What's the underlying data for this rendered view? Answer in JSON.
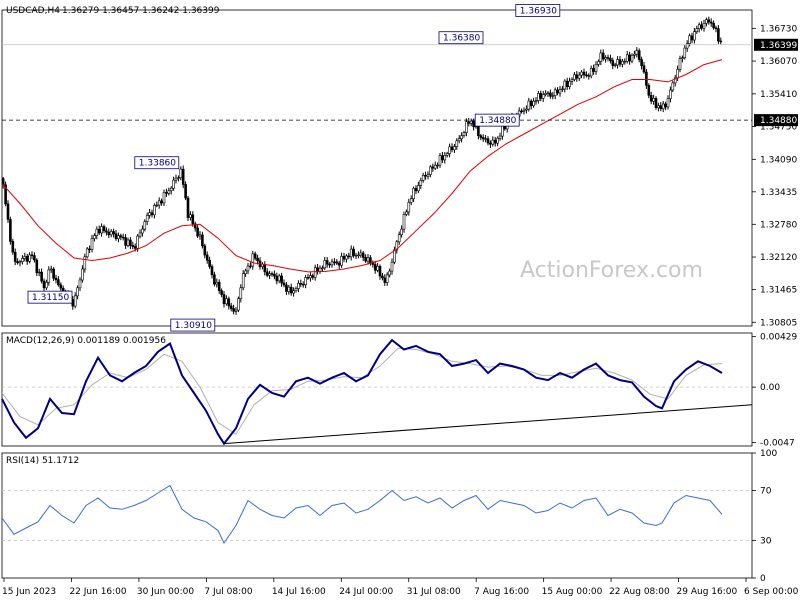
{
  "header": {
    "symbol": "USDCAD,H4",
    "ohlc": "1.36279 1.36457 1.36242 1.36399"
  },
  "watermark": "ActionForex.com",
  "colors": {
    "background": "#ffffff",
    "candle": "#000000",
    "ma": "#dd0000",
    "macd": "#000080",
    "signal": "#b0b0b0",
    "level_box_border": "#000080",
    "price_tag_bg": "#000000",
    "price_tag_text": "#ffffff",
    "grid": "#c0c0c0",
    "axis_text": "#000000",
    "watermark": "#c8c8c8"
  },
  "chart_data": [
    {
      "type": "candlestick",
      "pane": "price",
      "title": "USDCAD,H4",
      "ylim": [
        1.3073,
        1.371
      ],
      "y_ticks": [
        "1.36730",
        "1.36070",
        "1.35410",
        "1.34750",
        "1.34090",
        "1.33435",
        "1.32780",
        "1.32120",
        "1.31465",
        "1.30805"
      ],
      "x_ticks": [
        "15 Jun 2023",
        "22 Jun 16:00",
        "30 Jun 00:00",
        "7 Jul 08:00",
        "14 Jul 16:00",
        "24 Jul 00:00",
        "31 Jul 08:00",
        "7 Aug 16:00",
        "15 Aug 00:00",
        "22 Aug 08:00",
        "29 Aug 16:00",
        "6 Sep 00:00"
      ],
      "current_price": "1.36399",
      "horizontal_level": "1.34880",
      "annotations": [
        {
          "label": "1.33860",
          "value": 1.3386,
          "pos": 0.298
        },
        {
          "label": "1.31150",
          "value": 1.3115,
          "pos": 0.12
        },
        {
          "label": "1.30910",
          "value": 1.3091,
          "pos": 0.318
        },
        {
          "label": "1.36380",
          "value": 1.3638,
          "pos": 0.805
        },
        {
          "label": "1.36930",
          "value": 1.3693,
          "pos": 0.933
        },
        {
          "label": "1.34880",
          "value": 1.3488,
          "pos": 0.872
        }
      ],
      "price_path": [
        [
          0.0,
          1.337
        ],
        [
          0.02,
          1.32
        ],
        [
          0.05,
          1.3215
        ],
        [
          0.07,
          1.315
        ],
        [
          0.08,
          1.319
        ],
        [
          0.1,
          1.314
        ],
        [
          0.12,
          1.3118
        ],
        [
          0.14,
          1.322
        ],
        [
          0.16,
          1.327
        ],
        [
          0.18,
          1.326
        ],
        [
          0.2,
          1.325
        ],
        [
          0.22,
          1.323
        ],
        [
          0.24,
          1.329
        ],
        [
          0.26,
          1.332
        ],
        [
          0.28,
          1.335
        ],
        [
          0.298,
          1.3386
        ],
        [
          0.31,
          1.33
        ],
        [
          0.33,
          1.325
        ],
        [
          0.35,
          1.3175
        ],
        [
          0.37,
          1.3125
        ],
        [
          0.39,
          1.31
        ],
        [
          0.4,
          1.317
        ],
        [
          0.42,
          1.3215
        ],
        [
          0.44,
          1.318
        ],
        [
          0.46,
          1.317
        ],
        [
          0.48,
          1.314
        ],
        [
          0.5,
          1.316
        ],
        [
          0.52,
          1.318
        ],
        [
          0.54,
          1.32
        ],
        [
          0.56,
          1.32
        ],
        [
          0.58,
          1.322
        ],
        [
          0.6,
          1.3215
        ],
        [
          0.62,
          1.3195
        ],
        [
          0.64,
          1.316
        ],
        [
          0.66,
          1.325
        ],
        [
          0.68,
          1.333
        ],
        [
          0.7,
          1.337
        ],
        [
          0.72,
          1.3395
        ],
        [
          0.74,
          1.342
        ],
        [
          0.76,
          1.3445
        ],
        [
          0.78,
          1.349
        ],
        [
          0.8,
          1.345
        ],
        [
          0.82,
          1.344
        ],
        [
          0.84,
          1.348
        ],
        [
          0.86,
          1.35
        ],
        [
          0.88,
          1.352
        ],
        [
          0.9,
          1.354
        ],
        [
          0.92,
          1.354
        ],
        [
          0.94,
          1.356
        ],
        [
          0.96,
          1.358
        ],
        [
          0.98,
          1.358
        ],
        [
          1.0,
          1.362
        ],
        [
          1.02,
          1.36
        ],
        [
          1.04,
          1.361
        ],
        [
          1.06,
          1.3625
        ],
        [
          1.07,
          1.358
        ],
        [
          1.08,
          1.353
        ],
        [
          1.1,
          1.351
        ],
        [
          1.11,
          1.353
        ],
        [
          1.12,
          1.357
        ],
        [
          1.14,
          1.364
        ],
        [
          1.16,
          1.3675
        ],
        [
          1.18,
          1.369
        ],
        [
          1.2,
          1.364
        ]
      ],
      "ma_path": [
        [
          0.0,
          1.336
        ],
        [
          0.03,
          1.332
        ],
        [
          0.06,
          1.3275
        ],
        [
          0.09,
          1.324
        ],
        [
          0.12,
          1.321
        ],
        [
          0.15,
          1.3205
        ],
        [
          0.18,
          1.321
        ],
        [
          0.21,
          1.322
        ],
        [
          0.24,
          1.3235
        ],
        [
          0.27,
          1.326
        ],
        [
          0.3,
          1.3275
        ],
        [
          0.33,
          1.3278
        ],
        [
          0.36,
          1.325
        ],
        [
          0.39,
          1.3215
        ],
        [
          0.42,
          1.32
        ],
        [
          0.45,
          1.3195
        ],
        [
          0.48,
          1.3188
        ],
        [
          0.51,
          1.3182
        ],
        [
          0.54,
          1.3183
        ],
        [
          0.57,
          1.3188
        ],
        [
          0.6,
          1.3195
        ],
        [
          0.63,
          1.3205
        ],
        [
          0.66,
          1.323
        ],
        [
          0.69,
          1.3265
        ],
        [
          0.72,
          1.33
        ],
        [
          0.75,
          1.334
        ],
        [
          0.78,
          1.3385
        ],
        [
          0.81,
          1.3415
        ],
        [
          0.84,
          1.344
        ],
        [
          0.87,
          1.346
        ],
        [
          0.9,
          1.348
        ],
        [
          0.93,
          1.35
        ],
        [
          0.96,
          1.352
        ],
        [
          0.99,
          1.3535
        ],
        [
          1.02,
          1.3555
        ],
        [
          1.05,
          1.357
        ],
        [
          1.08,
          1.357
        ],
        [
          1.11,
          1.3565
        ],
        [
          1.14,
          1.358
        ],
        [
          1.17,
          1.36
        ],
        [
          1.2,
          1.361
        ]
      ]
    },
    {
      "type": "line",
      "pane": "macd",
      "title": "MACD(12,26,9) 0.001189 0.001956",
      "ylim": [
        -0.005,
        0.0046
      ],
      "y_ticks": [
        "0.00429",
        "0.00",
        "-0.0047"
      ],
      "series": [
        {
          "name": "MACD",
          "values": [
            [
              0.0,
              -0.001
            ],
            [
              0.02,
              -0.003
            ],
            [
              0.04,
              -0.0043
            ],
            [
              0.06,
              -0.0035
            ],
            [
              0.08,
              -0.001
            ],
            [
              0.1,
              -0.0022
            ],
            [
              0.12,
              -0.0023
            ],
            [
              0.14,
              0.0005
            ],
            [
              0.16,
              0.0025
            ],
            [
              0.18,
              0.001
            ],
            [
              0.2,
              0.0005
            ],
            [
              0.22,
              0.0012
            ],
            [
              0.24,
              0.0018
            ],
            [
              0.26,
              0.003
            ],
            [
              0.28,
              0.0037
            ],
            [
              0.3,
              0.001
            ],
            [
              0.32,
              -0.0005
            ],
            [
              0.34,
              -0.002
            ],
            [
              0.36,
              -0.004
            ],
            [
              0.37,
              -0.0048
            ],
            [
              0.39,
              -0.0035
            ],
            [
              0.41,
              -0.001
            ],
            [
              0.43,
              0.0002
            ],
            [
              0.45,
              -0.0005
            ],
            [
              0.47,
              -0.0008
            ],
            [
              0.49,
              0.0005
            ],
            [
              0.51,
              0.0008
            ],
            [
              0.53,
              0.0003
            ],
            [
              0.55,
              0.0008
            ],
            [
              0.57,
              0.0012
            ],
            [
              0.59,
              0.0005
            ],
            [
              0.61,
              0.001
            ],
            [
              0.63,
              0.0028
            ],
            [
              0.65,
              0.004
            ],
            [
              0.67,
              0.0032
            ],
            [
              0.69,
              0.0035
            ],
            [
              0.71,
              0.003
            ],
            [
              0.73,
              0.0028
            ],
            [
              0.75,
              0.0018
            ],
            [
              0.77,
              0.002
            ],
            [
              0.79,
              0.0023
            ],
            [
              0.81,
              0.0012
            ],
            [
              0.83,
              0.002
            ],
            [
              0.85,
              0.0018
            ],
            [
              0.87,
              0.0015
            ],
            [
              0.89,
              0.0008
            ],
            [
              0.91,
              0.0006
            ],
            [
              0.93,
              0.0012
            ],
            [
              0.95,
              0.0008
            ],
            [
              0.97,
              0.0015
            ],
            [
              0.99,
              0.002
            ],
            [
              1.01,
              0.001
            ],
            [
              1.03,
              0.0006
            ],
            [
              1.05,
              0.0004
            ],
            [
              1.07,
              -0.0008
            ],
            [
              1.09,
              -0.0016
            ],
            [
              1.1,
              -0.0018
            ],
            [
              1.12,
              0.0005
            ],
            [
              1.14,
              0.0015
            ],
            [
              1.16,
              0.0022
            ],
            [
              1.18,
              0.0018
            ],
            [
              1.2,
              0.0012
            ]
          ]
        },
        {
          "name": "Signal",
          "values": [
            [
              0.0,
              -0.0005
            ],
            [
              0.03,
              -0.0025
            ],
            [
              0.06,
              -0.0032
            ],
            [
              0.09,
              -0.0018
            ],
            [
              0.12,
              -0.0015
            ],
            [
              0.15,
              0.0002
            ],
            [
              0.18,
              0.0012
            ],
            [
              0.21,
              0.0008
            ],
            [
              0.24,
              0.0015
            ],
            [
              0.27,
              0.0028
            ],
            [
              0.3,
              0.0022
            ],
            [
              0.33,
              0.0
            ],
            [
              0.36,
              -0.003
            ],
            [
              0.39,
              -0.004
            ],
            [
              0.42,
              -0.0015
            ],
            [
              0.45,
              -0.0003
            ],
            [
              0.48,
              -0.0002
            ],
            [
              0.51,
              0.0005
            ],
            [
              0.54,
              0.0006
            ],
            [
              0.57,
              0.0009
            ],
            [
              0.6,
              0.0008
            ],
            [
              0.63,
              0.0018
            ],
            [
              0.66,
              0.0033
            ],
            [
              0.69,
              0.0032
            ],
            [
              0.72,
              0.0028
            ],
            [
              0.75,
              0.0022
            ],
            [
              0.78,
              0.002
            ],
            [
              0.81,
              0.0017
            ],
            [
              0.84,
              0.0018
            ],
            [
              0.87,
              0.0015
            ],
            [
              0.9,
              0.001
            ],
            [
              0.93,
              0.001
            ],
            [
              0.96,
              0.0013
            ],
            [
              0.99,
              0.0016
            ],
            [
              1.02,
              0.0012
            ],
            [
              1.05,
              0.0006
            ],
            [
              1.08,
              -0.0006
            ],
            [
              1.11,
              -0.001
            ],
            [
              1.14,
              0.001
            ],
            [
              1.17,
              0.0019
            ],
            [
              1.2,
              0.002
            ]
          ]
        }
      ],
      "trendline": [
        [
          0.37,
          -0.0048
        ],
        [
          1.25,
          -0.0015
        ]
      ]
    },
    {
      "type": "line",
      "pane": "rsi",
      "title": "RSI(14) 51.1712",
      "ylim": [
        0,
        100
      ],
      "y_ticks": [
        "100",
        "70",
        "30",
        "0"
      ],
      "levels": [
        70,
        30
      ],
      "series": [
        {
          "name": "RSI",
          "values": [
            [
              0.0,
              48
            ],
            [
              0.02,
              35
            ],
            [
              0.04,
              40
            ],
            [
              0.06,
              45
            ],
            [
              0.08,
              58
            ],
            [
              0.1,
              50
            ],
            [
              0.12,
              44
            ],
            [
              0.14,
              58
            ],
            [
              0.16,
              64
            ],
            [
              0.18,
              56
            ],
            [
              0.2,
              55
            ],
            [
              0.22,
              58
            ],
            [
              0.24,
              62
            ],
            [
              0.26,
              68
            ],
            [
              0.28,
              74
            ],
            [
              0.3,
              55
            ],
            [
              0.32,
              48
            ],
            [
              0.34,
              45
            ],
            [
              0.36,
              38
            ],
            [
              0.37,
              28
            ],
            [
              0.39,
              42
            ],
            [
              0.41,
              62
            ],
            [
              0.43,
              55
            ],
            [
              0.45,
              50
            ],
            [
              0.47,
              48
            ],
            [
              0.49,
              56
            ],
            [
              0.51,
              58
            ],
            [
              0.53,
              50
            ],
            [
              0.55,
              58
            ],
            [
              0.57,
              60
            ],
            [
              0.59,
              52
            ],
            [
              0.61,
              55
            ],
            [
              0.63,
              62
            ],
            [
              0.65,
              70
            ],
            [
              0.67,
              62
            ],
            [
              0.69,
              65
            ],
            [
              0.71,
              60
            ],
            [
              0.73,
              64
            ],
            [
              0.75,
              56
            ],
            [
              0.77,
              62
            ],
            [
              0.79,
              66
            ],
            [
              0.81,
              55
            ],
            [
              0.83,
              62
            ],
            [
              0.85,
              60
            ],
            [
              0.87,
              58
            ],
            [
              0.89,
              52
            ],
            [
              0.91,
              54
            ],
            [
              0.93,
              60
            ],
            [
              0.95,
              56
            ],
            [
              0.97,
              62
            ],
            [
              0.99,
              64
            ],
            [
              1.01,
              50
            ],
            [
              1.03,
              55
            ],
            [
              1.05,
              52
            ],
            [
              1.07,
              44
            ],
            [
              1.09,
              42
            ],
            [
              1.1,
              44
            ],
            [
              1.12,
              60
            ],
            [
              1.14,
              66
            ],
            [
              1.16,
              64
            ],
            [
              1.18,
              62
            ],
            [
              1.2,
              51
            ]
          ]
        }
      ]
    }
  ]
}
